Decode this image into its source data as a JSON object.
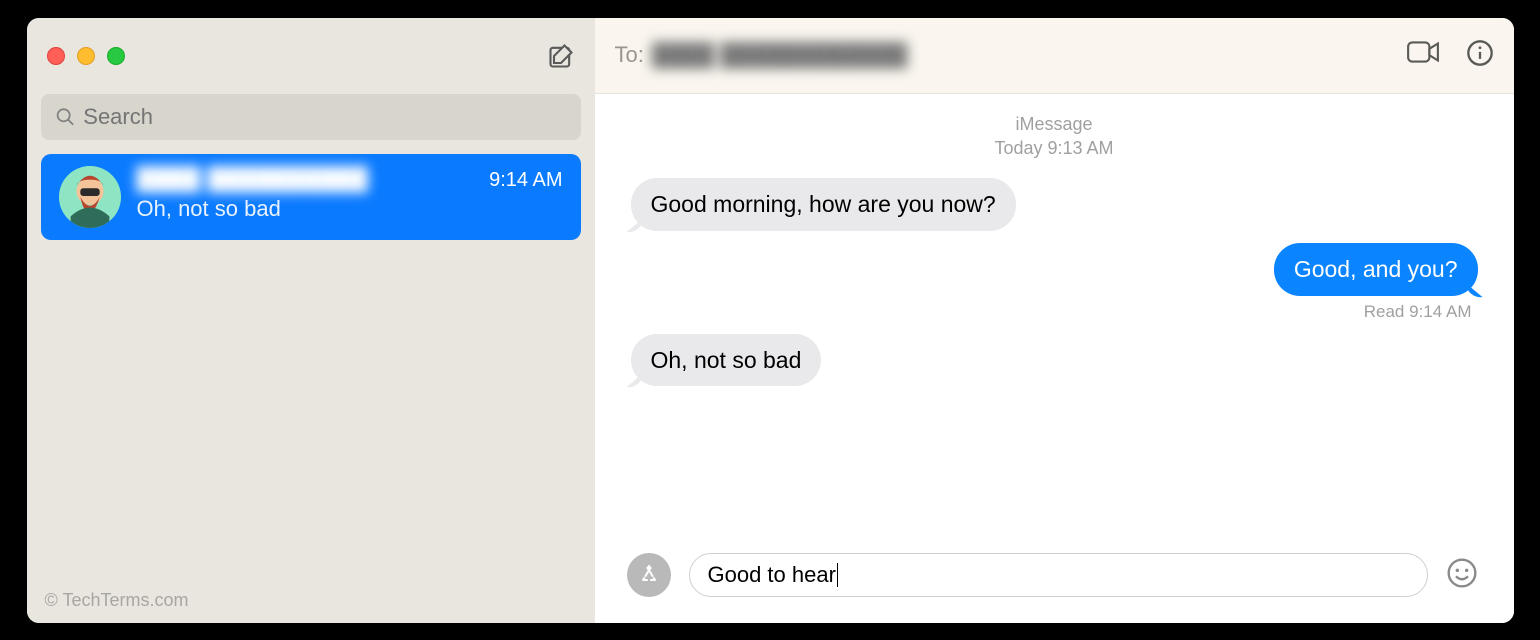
{
  "sidebar": {
    "search_placeholder": "Search",
    "conversations": [
      {
        "name": "████ ██████████",
        "time": "9:14 AM",
        "preview": "Oh, not so bad"
      }
    ],
    "attribution": "© TechTerms.com"
  },
  "header": {
    "to_label": "To:",
    "to_value": "████ ████████████"
  },
  "thread": {
    "service": "iMessage",
    "timestamp": "Today 9:13 AM",
    "messages": [
      {
        "side": "received",
        "text": "Good morning, how are you now?"
      },
      {
        "side": "sent",
        "text": "Good, and you?",
        "receipt": "Read 9:14 AM"
      },
      {
        "side": "received",
        "text": "Oh, not so bad"
      }
    ]
  },
  "composer": {
    "draft": "Good to hear"
  }
}
